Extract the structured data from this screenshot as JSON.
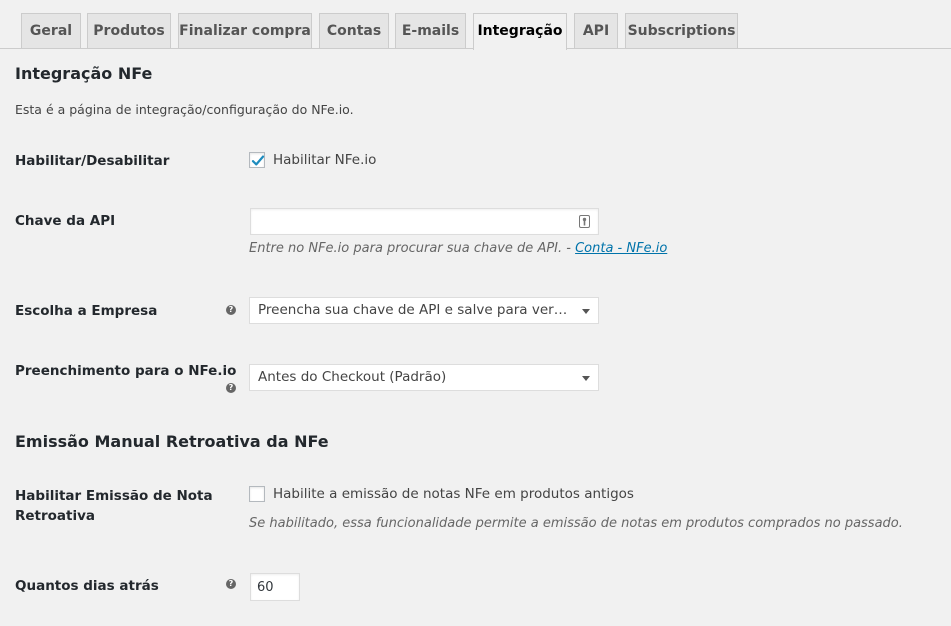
{
  "tabs": [
    {
      "label": "Geral"
    },
    {
      "label": "Produtos"
    },
    {
      "label": "Finalizar compra"
    },
    {
      "label": "Contas"
    },
    {
      "label": "E-mails"
    },
    {
      "label": "Integração",
      "active": true
    },
    {
      "label": "API"
    },
    {
      "label": "Subscriptions"
    }
  ],
  "section1": {
    "title": "Integração NFe",
    "description": "Esta é a página de integração/configuração do NFe.io."
  },
  "enable": {
    "label": "Habilitar/Desabilitar",
    "checkbox_label": "Habilitar NFe.io",
    "checked": true
  },
  "api_key": {
    "label": "Chave da API",
    "value": "",
    "hint_text": "Entre no NFe.io para procurar sua chave de API. - ",
    "hint_link": "Conta - NFe.io"
  },
  "company": {
    "label": "Escolha a Empresa",
    "selected": "Preencha sua chave de API e salve para ver sua empresa"
  },
  "fill": {
    "label": "Preenchimento para o NFe.io",
    "selected": "Antes do Checkout (Padrão)"
  },
  "section2": {
    "title": "Emissão Manual Retroativa da NFe"
  },
  "retro": {
    "label": "Habilitar Emissão de Nota Retroativa",
    "checkbox_label": "Habilite a emissão de notas NFe em produtos antigos",
    "checked": false,
    "hint": "Se habilitado, essa funcionalidade permite a emissão de notas em produtos comprados no passado."
  },
  "days": {
    "label": "Quantos dias atrás",
    "value": "60"
  },
  "icons": {
    "help": "question-circle-icon",
    "key": "password-manager-key-icon",
    "check": "checkmark-icon",
    "dropdown": "chevron-down-icon"
  },
  "colors": {
    "background": "#f1f1f1",
    "link": "#0073aa",
    "checkmark": "#1e8cbe"
  }
}
